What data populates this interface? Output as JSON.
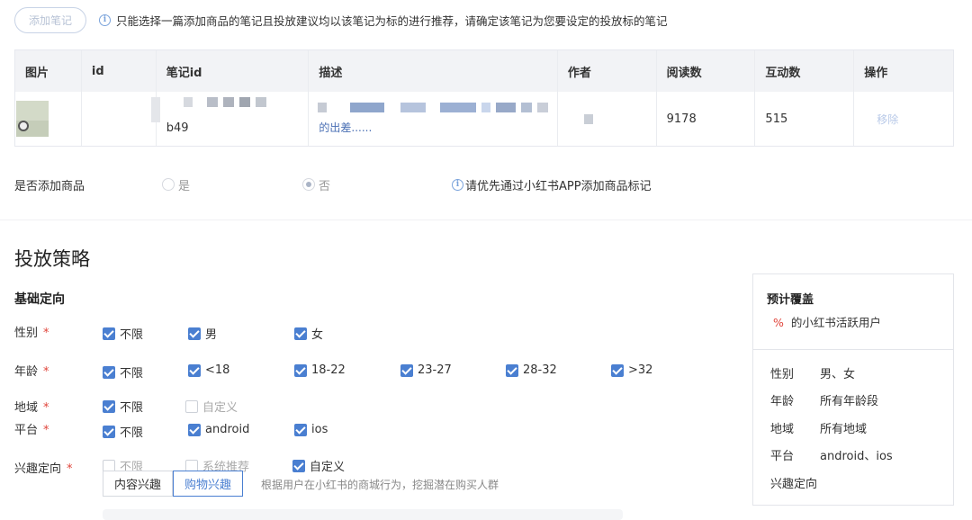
{
  "top": {
    "add_note_button": "添加笔记",
    "notice": "只能选择一篇添加商品的笔记且投放建议均以该笔记为标的进行推荐，请确定该笔记为您要设定的投放标的笔记"
  },
  "table": {
    "headers": [
      "图片",
      "id",
      "笔记id",
      "描述",
      "作者",
      "阅读数",
      "互动数",
      "操作"
    ],
    "row": {
      "note_id_suffix": "b49",
      "description_tail": "的出差......",
      "reads": "9178",
      "interactions": "515",
      "action": "移除"
    }
  },
  "product": {
    "label": "是否添加商品",
    "yes": "是",
    "no": "否",
    "hint": "请优先通过小红书APP添加商品标记"
  },
  "strategy": {
    "title": "投放策略",
    "basic_title": "基础定向",
    "gender": {
      "label": "性别",
      "options": [
        "不限",
        "男",
        "女"
      ]
    },
    "age": {
      "label": "年龄",
      "options": [
        "不限",
        "<18",
        "18-22",
        "23-27",
        "28-32",
        ">32"
      ]
    },
    "region": {
      "label": "地域",
      "options": [
        "不限",
        "自定义"
      ]
    },
    "platform": {
      "label": "平台",
      "options": [
        "不限",
        "android",
        "ios"
      ]
    },
    "interest": {
      "label": "兴趣定向",
      "options": [
        "不限",
        "系统推荐",
        "自定义"
      ]
    },
    "tabs": [
      "内容兴趣",
      "购物兴趣"
    ],
    "tab_hint": "根据用户在小红书的商城行为，挖掘潜在购买人群",
    "required_mark": "*"
  },
  "coverage": {
    "title": "预计覆盖",
    "pct_symbol": "%",
    "pct_text": "的小红书活跃用户",
    "rows": [
      {
        "k": "性别",
        "v": "男、女"
      },
      {
        "k": "年龄",
        "v": "所有年龄段"
      },
      {
        "k": "地域",
        "v": "所有地域"
      },
      {
        "k": "平台",
        "v": "android、ios"
      },
      {
        "k": "兴趣定向",
        "v": ""
      }
    ]
  },
  "colors": {
    "accent": "#4a7fd1",
    "required": "#e0443a"
  }
}
